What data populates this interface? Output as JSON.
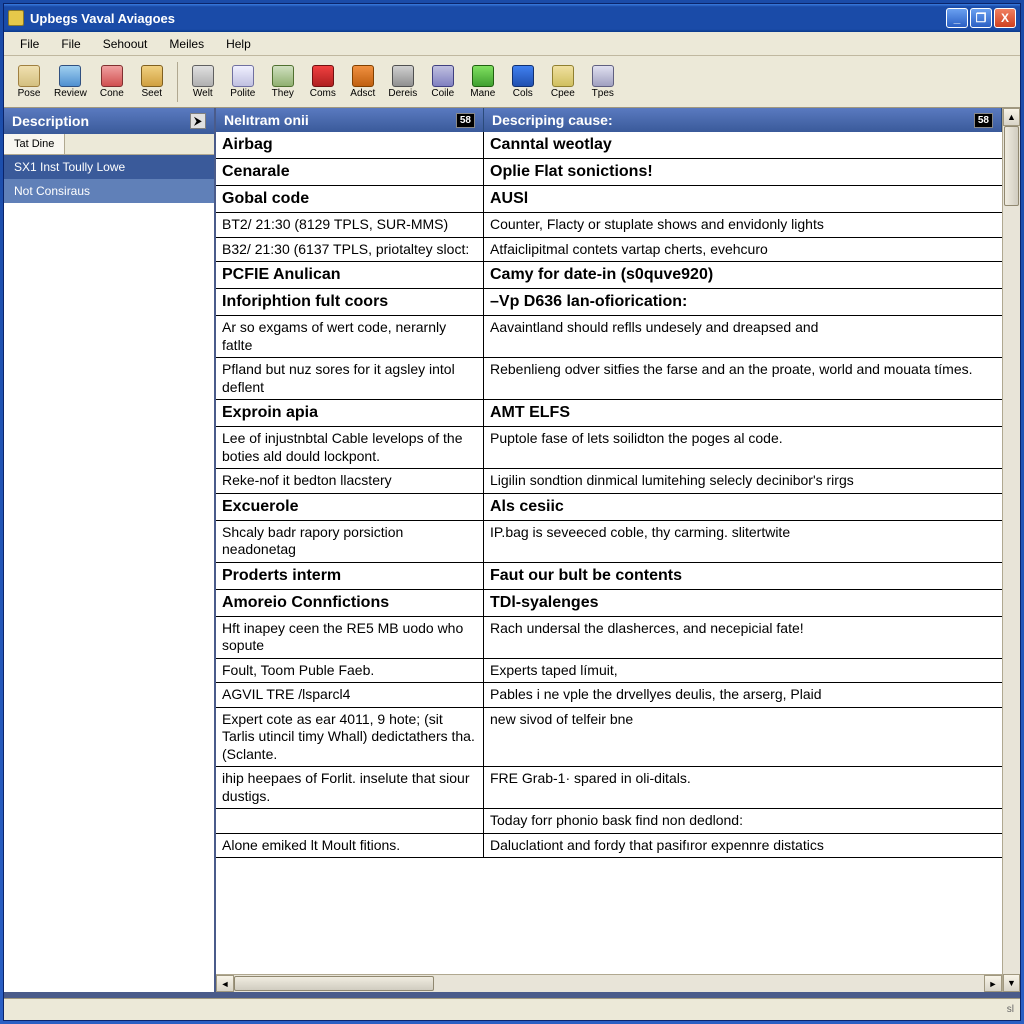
{
  "window": {
    "title": "Upbegs Vaval Aviagoes"
  },
  "menu": [
    "File",
    "File",
    "Sehoout",
    "Meiles",
    "Help"
  ],
  "toolbar": [
    {
      "label": "Pose"
    },
    {
      "label": "Review"
    },
    {
      "label": "Cone"
    },
    {
      "label": "Seet"
    },
    {
      "sep": true
    },
    {
      "label": "Welt"
    },
    {
      "label": "Polite"
    },
    {
      "label": "They"
    },
    {
      "label": "Coms"
    },
    {
      "label": "Adsct"
    },
    {
      "label": "Dereis"
    },
    {
      "label": "Coile"
    },
    {
      "label": "Mane"
    },
    {
      "label": "Cols"
    },
    {
      "label": "Cpee"
    },
    {
      "label": "Tpes"
    }
  ],
  "sidebar": {
    "header": "Description",
    "tab": "Tat Dine",
    "items": [
      {
        "label": "SX1 Inst Toully Lowe",
        "sel": true
      },
      {
        "label": "Not Consiraus",
        "alt": true
      }
    ]
  },
  "columns": {
    "left": "Nelıtram onii",
    "left_badge": "58",
    "right": "Descriping cause:",
    "right_badge": "58"
  },
  "rows": [
    {
      "h": true,
      "l": "Airbag",
      "r": "Canntal weotlay"
    },
    {
      "h": true,
      "l": "Cenarale",
      "r": "Oplie Flat sonictions!"
    },
    {
      "h": true,
      "l": "Gobal code",
      "r": "AUSl"
    },
    {
      "l": "BT2/ 21:30 (8129 TPLS, SUR-MMS)",
      "r": "Counter, Flacty or stuplate shows and envidonly lights"
    },
    {
      "l": "B32/ 21:30 (6137 TPLS, priotaltey sloct:",
      "r": "Atfaiclipitmal contets vartap cherts, evehcuro"
    },
    {
      "h": true,
      "l": "PCFIE Anulican",
      "r": "Camy for date-in (s0quve920)"
    },
    {
      "h": true,
      "l": "Inforiphtion fult coors",
      "r": "–Vp D636 lan-ofiorication:"
    },
    {
      "l": "Ar so exgams of wert code, nerarnly fatlte",
      "r": "Aavaintland should reflls undesely and dreapsed and"
    },
    {
      "l": "Pfland but nuz sores for it agsley intol deflent",
      "r": "Rebenlieng odver sitfies the farse and an the proate, world and mouata tímes."
    },
    {
      "h": true,
      "l": "Exproin apia",
      "r": "AMT ELFS"
    },
    {
      "l": "Lee of injustnbtal Cable levelops of the boties ald dould lockpont.",
      "r": "Puptole fase of lets soilidton the poges al code."
    },
    {
      "l": "Reke-nof it bedton llacstery",
      "r": "Ligilin sondtion dinmical lumitehing selecly decinibor's rirgs"
    },
    {
      "h": true,
      "l": "Excuerole",
      "r": "Als cesiic"
    },
    {
      "l": "Shcaly badr rapory porsiction neadonetag",
      "r": "IP.bag is seveeced coble, thy carming. slitertwite"
    },
    {
      "h": true,
      "l": "Proderts interm",
      "r": "Faut our bult be contents"
    },
    {
      "h": true,
      "l": "Amoreio Connfictions",
      "r": "TDl-syalenges"
    },
    {
      "l": "Hft inapey ceen the RE5 MB uodo who sopute",
      "r": "Rach undersal the dlasherces, and necepicial fate!"
    },
    {
      "l": "Foult, Toom Puble Faeb.",
      "r": "Experts taped límuit,"
    },
    {
      "l": "AGVIL TRE /lsparcl4",
      "r": "Pables i ne vple the drvellyes deulis, the arserg, Plaid"
    },
    {
      "l": "Expert cote as ear 4011, 9 hote; (sit Tarlis utincil timy Whall) dedictathers tha. (Sclante.",
      "r": "new sivod of telfeir bne"
    },
    {
      "l": "ihip heepaes of Forlit. inselute that siour dustigs.",
      "r": "FRE Grab-1· spared in oli-ditals."
    },
    {
      "l": "",
      "r": "Today forr phonio bask find non dedlond:"
    },
    {
      "l": "Alone emiked lt Moult fitions.",
      "r": "Daluclationt and fordy that pasifıror expennre distatics"
    }
  ],
  "status": "sl"
}
